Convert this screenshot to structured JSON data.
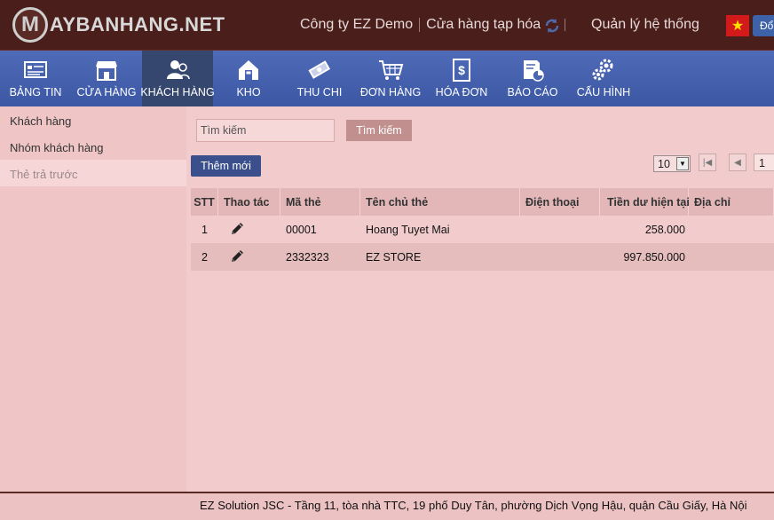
{
  "header": {
    "logo_letter": "M",
    "logo_text": "AYBANHANG.NET",
    "company": "Công ty EZ Demo",
    "store": "Cửa hàng tạp hóa",
    "admin": "Quản lý hệ thống",
    "lang_label": "Đổ",
    "flag_icon": "vietnam-flag-icon"
  },
  "nav": {
    "items": [
      {
        "label": "Bảng tin",
        "icon": "dashboard-icon"
      },
      {
        "label": "Cửa hàng",
        "icon": "store-icon"
      },
      {
        "label": "Khách hàng",
        "icon": "customers-icon",
        "active": true
      },
      {
        "label": "Kho",
        "icon": "warehouse-icon"
      },
      {
        "label": "Thu chi",
        "icon": "money-icon"
      },
      {
        "label": "Đơn hàng",
        "icon": "cart-icon"
      },
      {
        "label": "Hóa đơn",
        "icon": "invoice-icon"
      },
      {
        "label": "Báo cáo",
        "icon": "report-icon"
      },
      {
        "label": "Cấu hình",
        "icon": "settings-icon"
      }
    ]
  },
  "sidebar": {
    "items": [
      {
        "label": "Khách hàng"
      },
      {
        "label": "Nhóm khách hàng"
      },
      {
        "label": "Thẻ trả trước",
        "active": true
      }
    ]
  },
  "main": {
    "search_placeholder": "Tìm kiếm",
    "search_button": "Tìm kiếm",
    "add_button": "Thêm mới",
    "page_size": "10",
    "page_number": "1"
  },
  "table": {
    "headers": {
      "stt": "STT",
      "action": "Thao tác",
      "code": "Mã thẻ",
      "owner": "Tên chủ thẻ",
      "phone": "Điện thoại",
      "balance": "Tiền dư hiện tại",
      "address": "Địa chỉ"
    },
    "rows": [
      {
        "stt": "1",
        "code": "00001",
        "owner": "Hoang Tuyet Mai",
        "phone": "",
        "balance": "258.000",
        "address": ""
      },
      {
        "stt": "2",
        "code": "2332323",
        "owner": "EZ STORE",
        "phone": "",
        "balance": "997.850.000",
        "address": ""
      }
    ]
  },
  "footer": {
    "text": "EZ Solution JSC - Tầng 11, tòa nhà TTC, 19 phố Duy Tân, phường Dịch Vọng Hậu, quận Cầu Giấy, Hà Nội"
  }
}
